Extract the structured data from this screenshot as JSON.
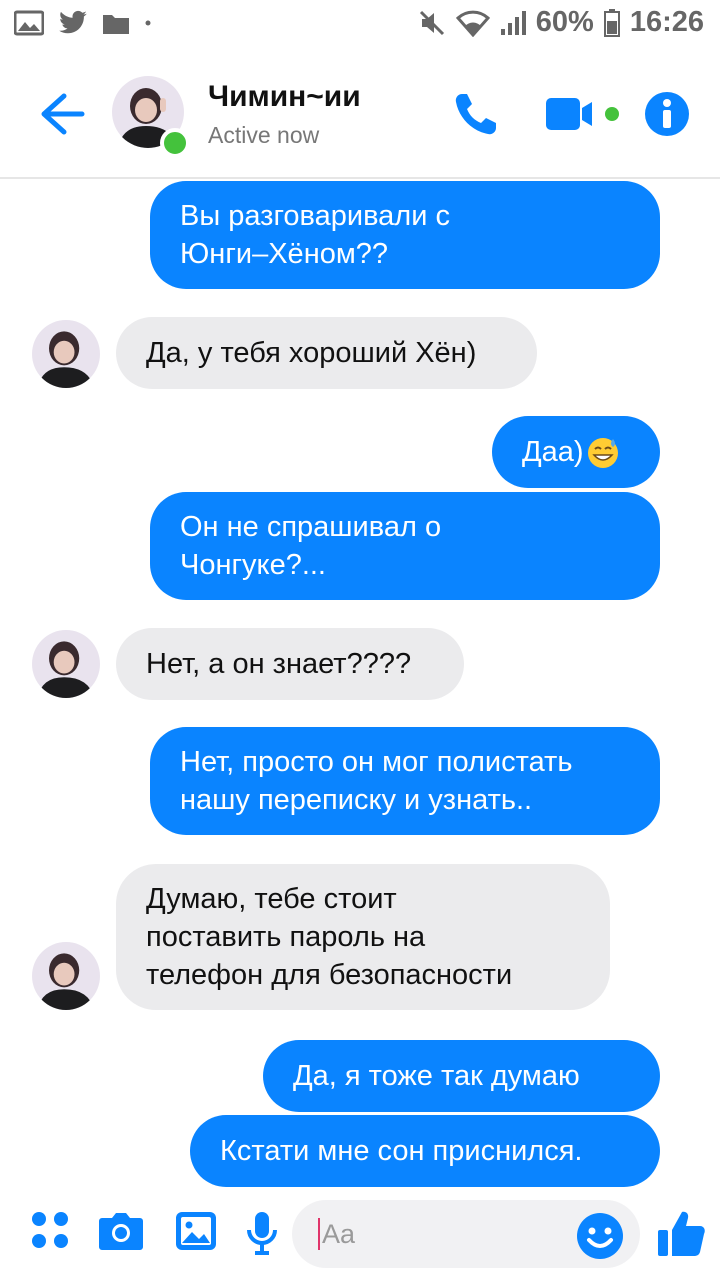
{
  "status_bar": {
    "battery": "60%",
    "time": "16:26",
    "icons": [
      "gallery-icon",
      "twitter-icon",
      "folder-icon",
      "dot-icon",
      "mute-icon",
      "wifi-icon",
      "signal-icon",
      "battery-icon"
    ]
  },
  "header": {
    "contact_name": "Чимин~ии",
    "status": "Active now",
    "icons": [
      "back-arrow-icon",
      "phone-icon",
      "video-camera-icon",
      "info-icon"
    ]
  },
  "messages": [
    {
      "dir": "out",
      "lines": [
        "Вы разговаривали с",
        "Юнги–Хёном??"
      ]
    },
    {
      "dir": "in",
      "lines": [
        "Да, у тебя хороший Хён)"
      ]
    },
    {
      "dir": "out",
      "lines": [
        "Даа)"
      ],
      "emoji": "grinning-sweat-emoji"
    },
    {
      "dir": "out",
      "lines": [
        "Он не спрашивал о",
        "Чонгуке?..."
      ]
    },
    {
      "dir": "in",
      "lines": [
        "Нет, а он знает????"
      ]
    },
    {
      "dir": "out",
      "lines": [
        "Нет, просто он мог полистать",
        "нашу переписку и узнать.."
      ]
    },
    {
      "dir": "in",
      "lines": [
        "Думаю, тебе стоит",
        "поставить пароль на",
        "телефон для безопасности"
      ]
    },
    {
      "dir": "out",
      "lines": [
        "Да, я тоже так думаю"
      ]
    },
    {
      "dir": "out",
      "lines": [
        "Кстати мне сон приснился."
      ]
    }
  ],
  "composer": {
    "placeholder": "Aa",
    "icons": [
      "apps-grid-icon",
      "camera-icon",
      "image-icon",
      "microphone-icon",
      "emoji-icon",
      "thumbs-up-icon"
    ]
  },
  "colors": {
    "accent": "#0a84ff",
    "incoming": "#ebebed",
    "online": "#44c23c"
  }
}
